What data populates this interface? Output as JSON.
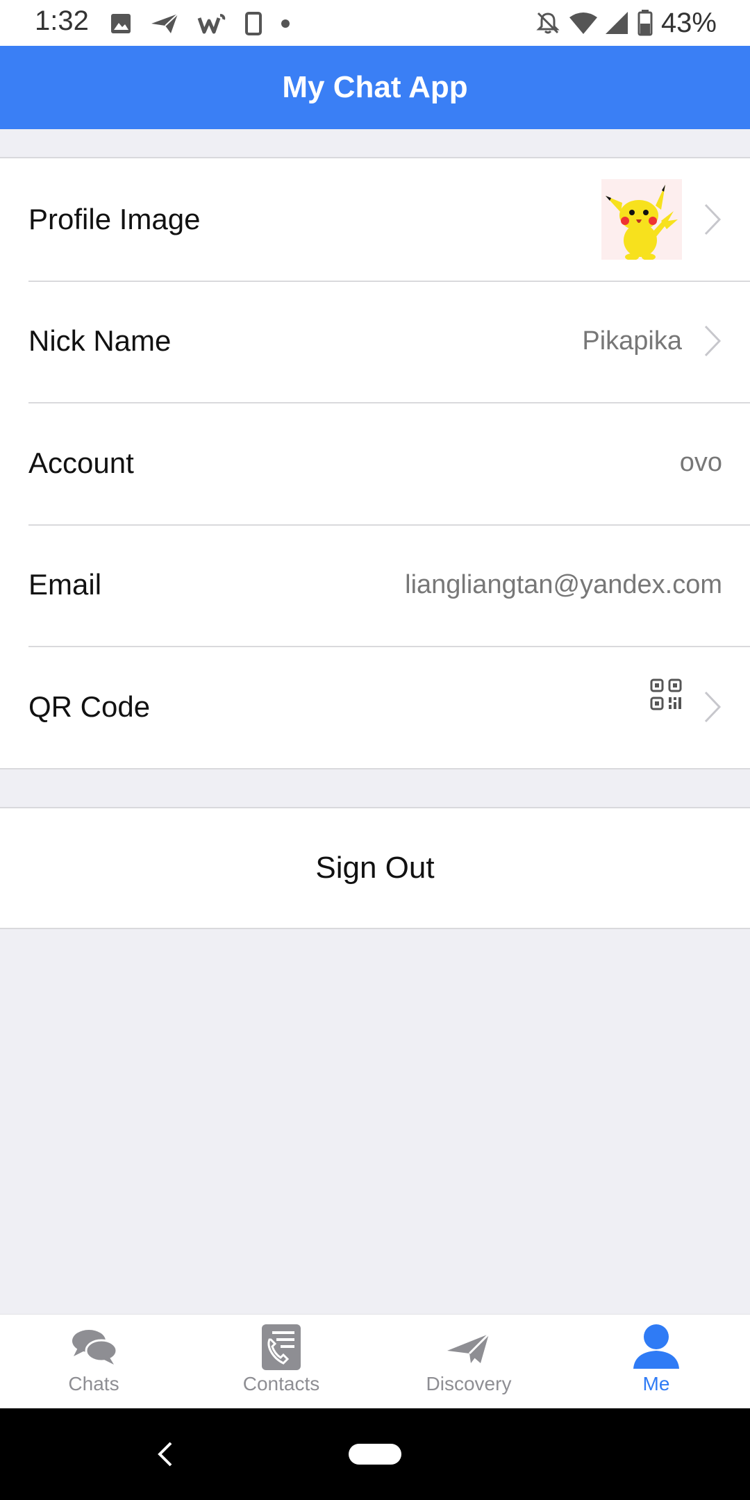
{
  "status_bar": {
    "time": "1:32",
    "battery": "43%",
    "left_icons": [
      "image-icon",
      "send-icon",
      "w-app-icon",
      "phone-outline-icon",
      "dot-icon"
    ],
    "right_icons": [
      "bell-off-icon",
      "wifi-icon",
      "signal-icon",
      "battery-icon"
    ]
  },
  "header": {
    "title": "My Chat App",
    "color": "#3a7ff5"
  },
  "profile": {
    "rows": [
      {
        "label": "Profile Image",
        "value": "",
        "icon": "pikachu-avatar"
      },
      {
        "label": "Nick Name",
        "value": "Pikapika"
      },
      {
        "label": "Account",
        "value": "ovo"
      },
      {
        "label": "Email",
        "value": "liangliangtan@yandex.com"
      },
      {
        "label": "QR Code",
        "value": "",
        "icon": "qr-code-icon"
      }
    ]
  },
  "sign_out": {
    "label": "Sign Out"
  },
  "tabs": [
    {
      "label": "Chats",
      "icon": "chat-bubbles-icon",
      "active": false
    },
    {
      "label": "Contacts",
      "icon": "contacts-icon",
      "active": false
    },
    {
      "label": "Discovery",
      "icon": "paper-plane-icon",
      "active": false
    },
    {
      "label": "Me",
      "icon": "person-icon",
      "active": true
    }
  ],
  "colors": {
    "accent": "#2f7bf5",
    "inactive_tab": "#8e8e93",
    "background": "#efeff4"
  }
}
